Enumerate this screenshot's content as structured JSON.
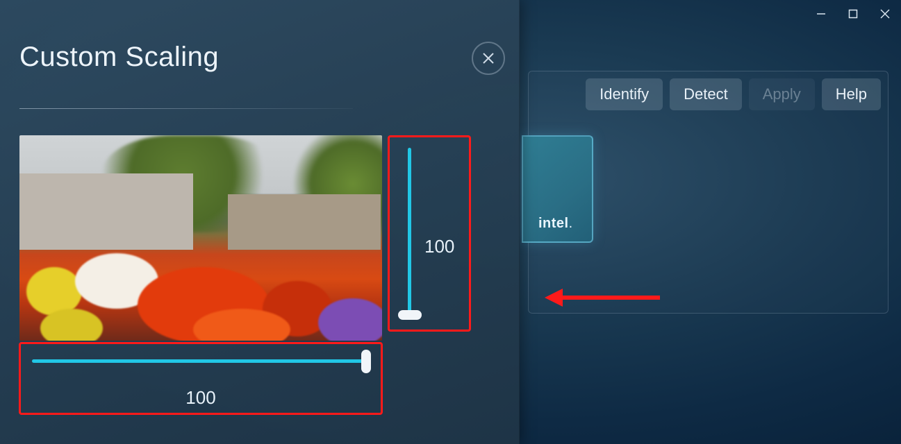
{
  "window": {
    "minimize_icon": "minimize",
    "maximize_icon": "maximize",
    "close_icon": "close"
  },
  "toolbar": {
    "identify_label": "Identify",
    "detect_label": "Detect",
    "apply_label": "Apply",
    "help_label": "Help",
    "apply_enabled": false
  },
  "monitor": {
    "brand_label": "intel"
  },
  "modal": {
    "title": "Custom Scaling",
    "close_icon": "close"
  },
  "scaling": {
    "horizontal_value": "100",
    "vertical_value": "100",
    "horizontal_percent": 100,
    "vertical_percent": 100
  },
  "annotation": {
    "arrow_color": "#ff1a1a",
    "box_color": "#ff1a1a"
  }
}
